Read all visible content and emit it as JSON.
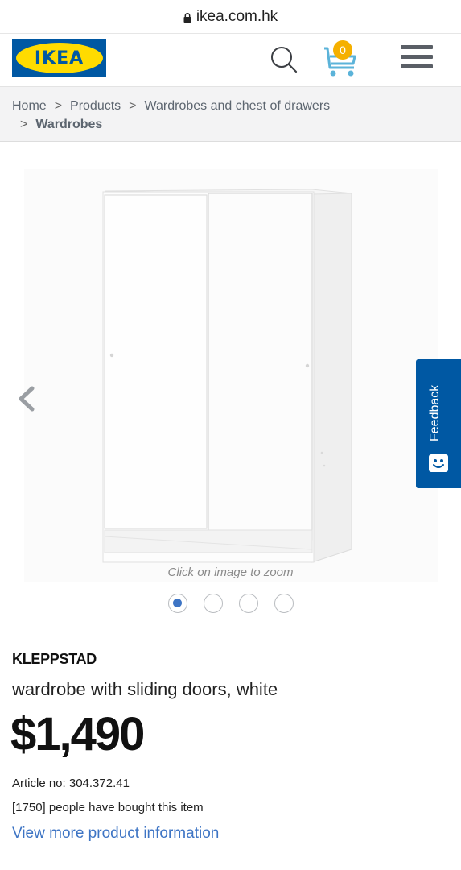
{
  "browser": {
    "url": "ikea.com.hk"
  },
  "header": {
    "logo_text": "IKEA",
    "cart_count": "0",
    "brand_colors": {
      "blue": "#0058a3",
      "yellow": "#ffdb00",
      "badge": "#f5b000"
    }
  },
  "breadcrumb": {
    "items": [
      "Home",
      "Products",
      "Wardrobes and chest of drawers",
      "Wardrobes"
    ],
    "separator": ">"
  },
  "gallery": {
    "zoom_hint": "Click on image to zoom",
    "image_count": 4,
    "active_index": 0
  },
  "feedback": {
    "label": "Feedback"
  },
  "product": {
    "name": "KLEPPSTAD",
    "description": "wardrobe with sliding doors, white",
    "price": "$1,490",
    "article": "Article no: 304.372.41",
    "bought": "[1750] people have bought this item",
    "more_link": "View more product information"
  }
}
